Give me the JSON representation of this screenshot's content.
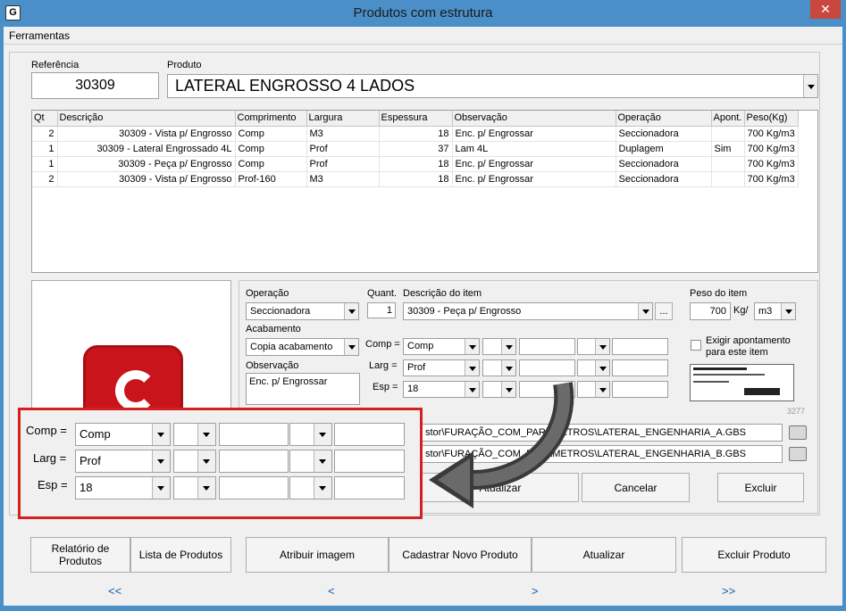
{
  "window": {
    "title": "Produtos com estrutura",
    "close_label": "✕",
    "icon_glyph": "G"
  },
  "menu": {
    "ferramentas": "Ferramentas"
  },
  "header": {
    "referencia_label": "Referência",
    "referencia_value": "30309",
    "produto_label": "Produto",
    "produto_value": "LATERAL ENGROSSO 4 LADOS"
  },
  "grid": {
    "columns": [
      "Qt",
      "Descrição",
      "Comprimento",
      "Largura",
      "Espessura",
      "Observação",
      "Operação",
      "Apont.",
      "Peso(Kg)"
    ],
    "rows": [
      [
        "2",
        "30309 -  Vista p/ Engrosso",
        "Comp",
        "M3",
        "18",
        "Enc. p/ Engrossar",
        "Seccionadora",
        "",
        "700 Kg/m3"
      ],
      [
        "1",
        "30309 - Lateral Engrossado 4L",
        "Comp",
        "Prof",
        "37",
        "Lam 4L",
        "Duplagem",
        "Sim",
        "700 Kg/m3"
      ],
      [
        "1",
        "30309 - Peça p/ Engrosso",
        "Comp",
        "Prof",
        "18",
        "Enc. p/ Engrossar",
        "Seccionadora",
        "",
        "700 Kg/m3"
      ],
      [
        "2",
        "30309 - Vista p/ Engrosso",
        "Prof-160",
        "M3",
        "18",
        "Enc. p/ Engrossar",
        "Seccionadora",
        "",
        "700 Kg/m3"
      ]
    ]
  },
  "detail": {
    "operacao_label": "Operação",
    "operacao_value": "Seccionadora",
    "quant_label": "Quant.",
    "quant_value": "1",
    "descricao_label": "Descrição do item",
    "descricao_value": "30309 - Peça p/ Engrosso",
    "ellipsis": "...",
    "peso_label": "Peso do item",
    "peso_value": "700",
    "peso_unit": "Kg/",
    "peso_unit_select": "m3",
    "acabamento_label": "Acabamento",
    "acabamento_value": "Copia acabamento",
    "observacao_label": "Observação",
    "observacao_value": "Enc. p/ Engrossar",
    "comp_label": "Comp =",
    "comp_value": "Comp",
    "larg_label": "Larg =",
    "larg_value": "Prof",
    "esp_label": "Esp =",
    "esp_value": "18",
    "exigir_label": "Exigir apontamento para este item",
    "label_code": "3277",
    "path_a": "stor\\FURAÇÃO_COM_PARAMETROS\\LATERAL_ENGENHARIA_A.GBS",
    "path_b": "stor\\FURAÇÃO_COM_PARAMETROS\\LATERAL_ENGENHARIA_B.GBS",
    "btn_atualizar": "Atualizar",
    "btn_cancelar": "Cancelar",
    "btn_excluir": "Excluir"
  },
  "callout": {
    "comp_label": "Comp =",
    "comp_value": "Comp",
    "larg_label": "Larg =",
    "larg_value": "Prof",
    "esp_label": "Esp =",
    "esp_value": "18"
  },
  "footer": {
    "relatorio": "Relatório de Produtos",
    "lista": "Lista de Produtos",
    "atribuir": "Atribuir imagem",
    "cadastrar": "Cadastrar Novo Produto",
    "atualizar": "Atualizar",
    "excluir_produto": "Excluir Produto",
    "nav_first": "<<",
    "nav_prev": "<",
    "nav_next": ">",
    "nav_last": ">>"
  },
  "colors": {
    "accent": "#4a8fc8",
    "callout_border": "#d61f1f",
    "logo_red": "#c8141a"
  }
}
